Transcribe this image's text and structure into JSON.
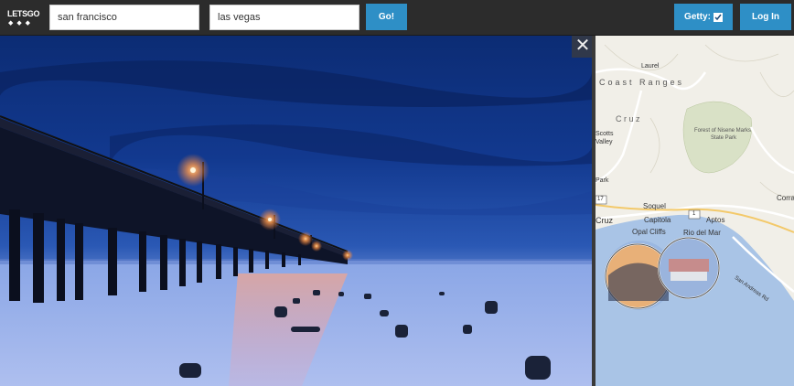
{
  "header": {
    "logo_text": "LETSGO",
    "origin_value": "san francisco",
    "destination_value": "las vegas",
    "go_label": "Go!",
    "getty_label": "Getty:",
    "getty_checked": true,
    "login_label": "Log In"
  },
  "photo": {
    "close_glyph": "✕"
  },
  "map": {
    "labels": {
      "laurel": "Laurel",
      "coast_ranges": "Coast Ranges",
      "cruz_range": "C r u z",
      "forest": "Forest of Nisene Marks",
      "state_park": "State Park",
      "scotts_valley_1": "Scotts",
      "scotts_valley_2": "Valley",
      "park": "Park",
      "soquel": "Soquel",
      "capitola": "Capitola",
      "aptos": "Aptos",
      "opal_cliffs": "Opal Cliffs",
      "rio_del_mar": "Rio del Mar",
      "cruz": "Cruz",
      "corral": "Corra",
      "san_andreas_rd": "San Andreas Rd",
      "route_17": "17",
      "route_1": "1"
    }
  },
  "colors": {
    "accent": "#2e8fc6",
    "topbar": "#2c2c2c",
    "map_water": "#a9c4e6",
    "map_land": "#f1efe8"
  }
}
